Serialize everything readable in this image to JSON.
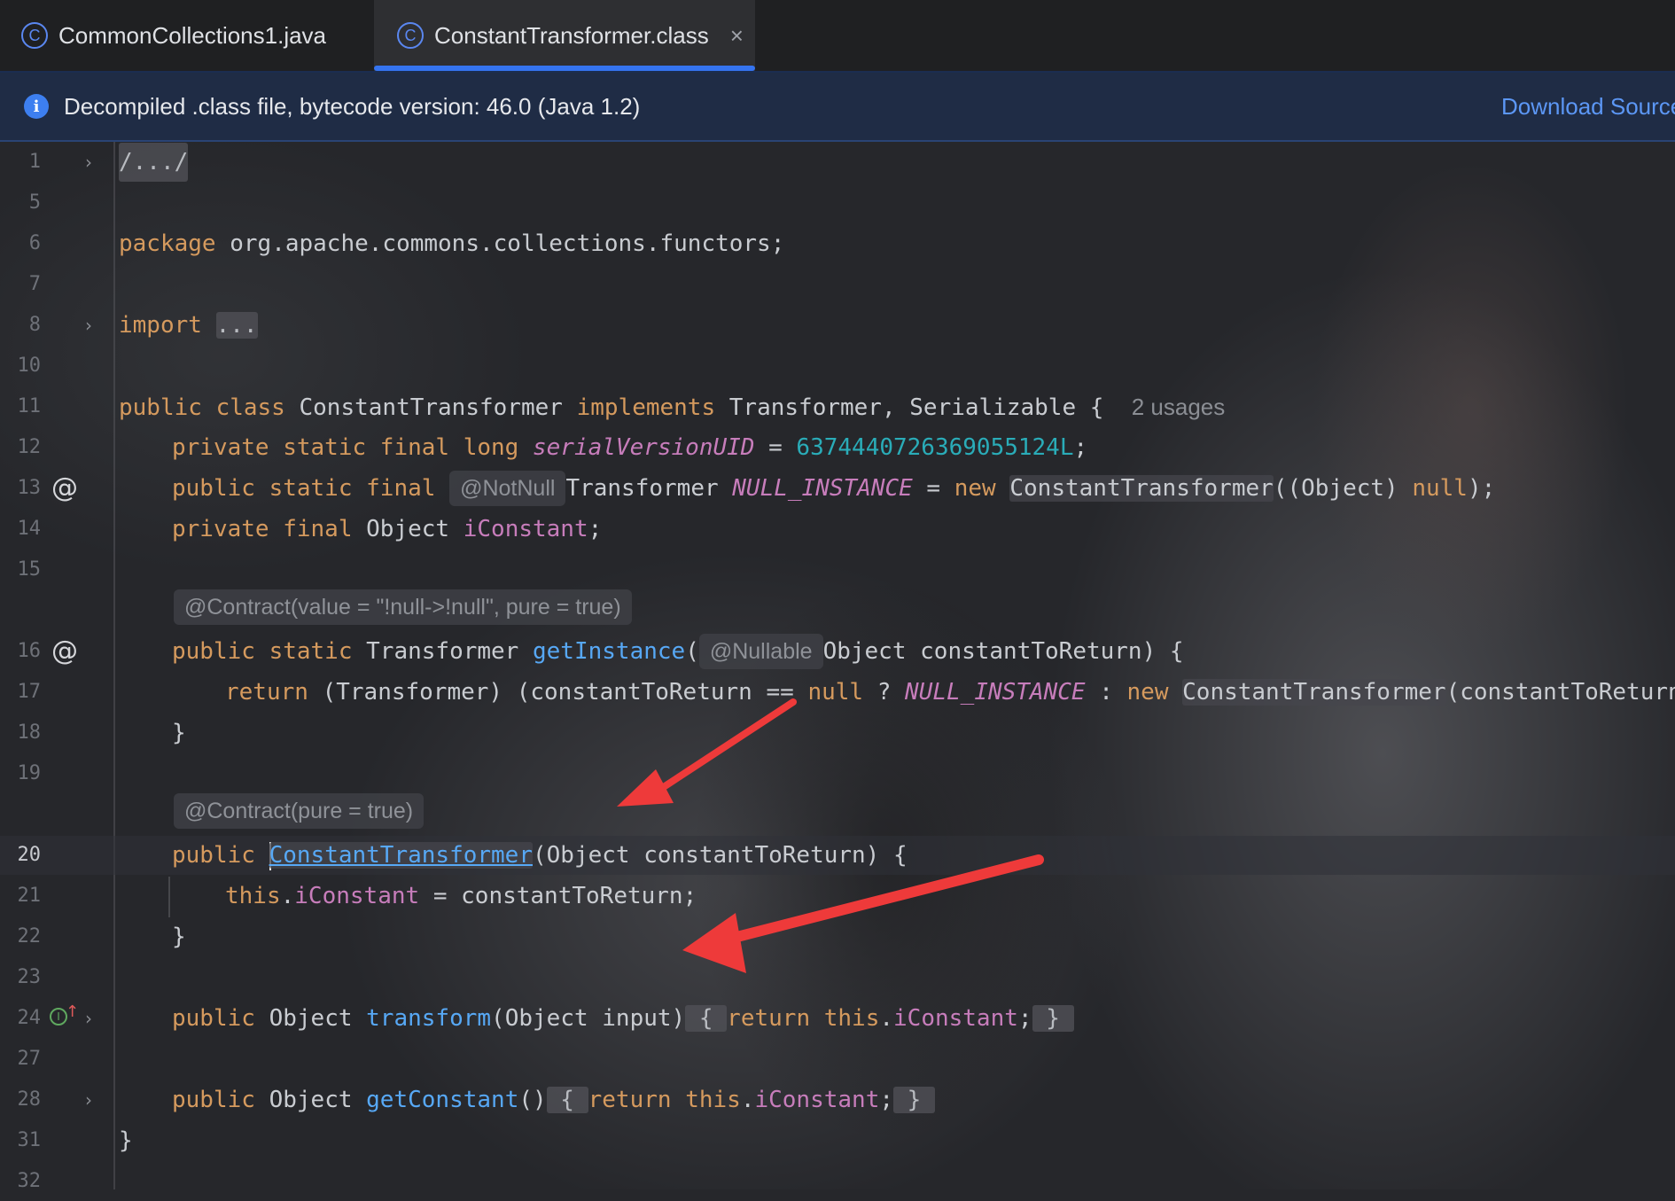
{
  "tabs": [
    {
      "label": "CommonCollections1.java"
    },
    {
      "label": "ConstantTransformer.class",
      "active": true,
      "close": "×"
    }
  ],
  "banner": {
    "message": "Decompiled .class file, bytecode version: 46.0 (Java 1.2)",
    "action": "Download Source"
  },
  "editor": {
    "line_numbers": [
      "1",
      "5",
      "6",
      "7",
      "8",
      "10",
      "11",
      "12",
      "13",
      "14",
      "15",
      "16",
      "17",
      "18",
      "19",
      "20",
      "21",
      "22",
      "23",
      "24",
      "27",
      "28",
      "31",
      "32"
    ],
    "current_line": "20",
    "fold_1": "/.../",
    "package_kw": "package",
    "package_name": " org.apache.commons.collections.functors;",
    "import_kw": "import",
    "import_fold": "...",
    "class_usages_hint": "2 usages",
    "notnull_hint": "@NotNull",
    "nullable_hint": "@Nullable",
    "contract1_hint": "@Contract(value = \"!null->!null\", pure = true)",
    "contract2_hint": "@Contract(pure = true)",
    "serial_value": "6374440726369055124L"
  },
  "colors": {
    "keyword": "#d59a5e",
    "method": "#57a8f5",
    "field": "#c77dbb",
    "number": "#2aacb8",
    "accent": "#3574f0",
    "annotation_arrow": "#ee3a3a"
  }
}
